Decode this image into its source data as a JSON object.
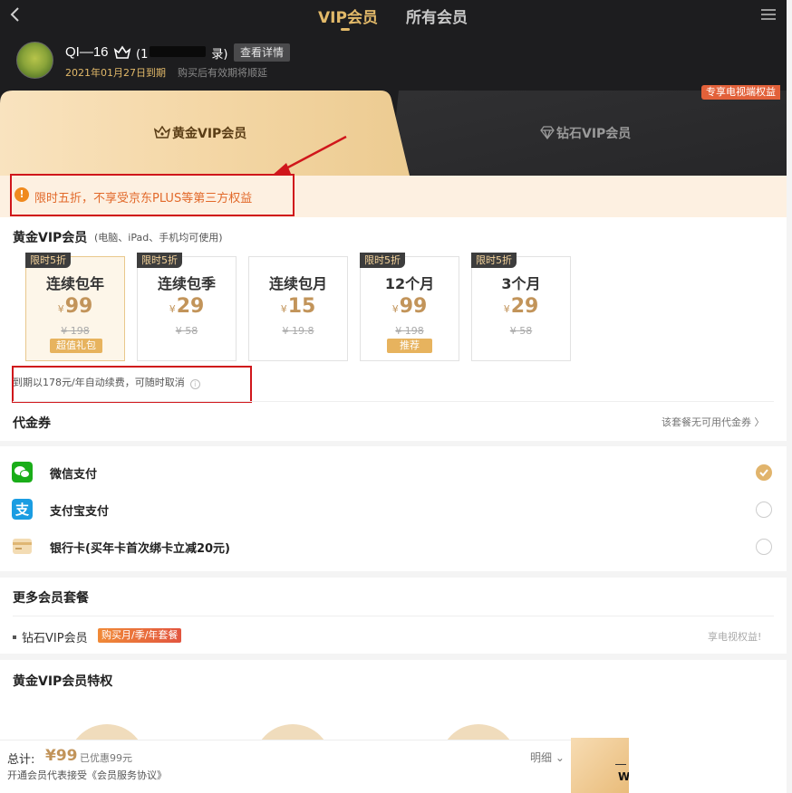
{
  "header": {
    "tabs": [
      {
        "label": "VIP会员",
        "active": true
      },
      {
        "label": "所有会员",
        "active": false
      }
    ],
    "user": {
      "name": "QI—16",
      "login_note": "(1",
      "login_note_tail": "录)",
      "details_button": "查看详情",
      "expire_text": "2021年01月27日到期",
      "extend_note": "购买后有效期将顺延"
    }
  },
  "tiers": {
    "gold_label": "黄金VIP会员",
    "diamond_label": "钻石VIP会员",
    "tv_badge": "专享电视端权益"
  },
  "notice": {
    "icon": "exclamation-icon",
    "text": "限时五折，不享受京东PLUS等第三方权益"
  },
  "plans": {
    "title": "黄金VIP会员",
    "subtitle": "(电脑、iPad、手机均可使用)",
    "items": [
      {
        "tag": "限时5折",
        "name": "连续包年",
        "currency": "¥",
        "price": "99",
        "original": "¥ 198",
        "badge": "超值礼包",
        "selected": true
      },
      {
        "tag": "限时5折",
        "name": "连续包季",
        "currency": "¥",
        "price": "29",
        "original": "¥ 58",
        "badge": "",
        "selected": false
      },
      {
        "tag": "",
        "name": "连续包月",
        "currency": "¥",
        "price": "15",
        "original": "¥ 19.8",
        "badge": "",
        "selected": false
      },
      {
        "tag": "限时5折",
        "name": "12个月",
        "currency": "¥",
        "price": "99",
        "original": "¥ 198",
        "badge": "推荐",
        "selected": false
      },
      {
        "tag": "限时5折",
        "name": "3个月",
        "currency": "¥",
        "price": "29",
        "original": "¥ 58",
        "badge": "",
        "selected": false
      }
    ],
    "renew_note": "到期以178元/年自动续费，可随时取消",
    "coupon_label": "代金券",
    "coupon_note": "该套餐无可用代金券 〉"
  },
  "payment": {
    "methods": [
      {
        "label": "微信支付",
        "icon": "wechat-icon",
        "color": "#1aad19",
        "checked": true
      },
      {
        "label": "支付宝支付",
        "icon": "alipay-icon",
        "color": "#1b9de2",
        "checked": false
      },
      {
        "label": "银行卡(买年卡首次绑卡立减20元)",
        "icon": "bank-card-icon",
        "color": "#e8c58e",
        "checked": false
      }
    ]
  },
  "more": {
    "title": "更多会员套餐",
    "item_label": "钻石VIP会员",
    "item_tag": "购买月/季/年套餐",
    "tv_link": "享电视权益!"
  },
  "privileges": {
    "title": "黄金VIP会员特权"
  },
  "footer": {
    "total_label": "总计:",
    "total_amount": "¥99",
    "discount": "已优惠99元",
    "agreement": "开通会员代表接受《会员服务协议》",
    "detail_button": "明细 ⌄",
    "pay_button_text": "W"
  },
  "colors": {
    "accent_gold": "#e2b969",
    "price_gold": "#c2945a",
    "notice_orange": "#e2692a",
    "annotation_red": "#d0161b",
    "header_dark": "#1d1d1f"
  }
}
